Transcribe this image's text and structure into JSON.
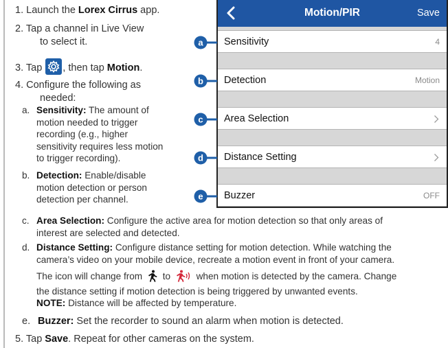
{
  "steps": {
    "s1": {
      "num": "1.",
      "pre": "Launch the ",
      "bold": "Lorex Cirrus",
      "post": " app."
    },
    "s2": {
      "num": "2.",
      "line1": "Tap a channel in Live View",
      "line2": "to select it."
    },
    "s3": {
      "num": "3.",
      "pre": "Tap ",
      "mid": ", then tap ",
      "bold": "Motion",
      "post": "."
    },
    "s4": {
      "num": "4.",
      "line1": "Configure the following as",
      "line2": "needed:"
    },
    "s5": {
      "num": "5.",
      "pre": "Tap ",
      "bold": "Save",
      "post": ". Repeat for other cameras on the system."
    }
  },
  "items": {
    "a": {
      "letter": "a.",
      "bold": "Sensitivity:",
      "l1": " The amount of",
      "l2": "motion needed to trigger",
      "l3": "recording (e.g., higher",
      "l4": "sensitivity requires less motion",
      "l5": "to trigger recording)."
    },
    "b": {
      "letter": "b.",
      "bold": "Detection:",
      "l1": " Enable/disable",
      "l2": "motion detection or person",
      "l3": "detection per channel."
    },
    "c": {
      "letter": "c.",
      "bold": "Area Selection:",
      "l1": " Configure the active area for motion detection so that only areas of",
      "l2": "interest are selected and detected."
    },
    "d": {
      "letter": "d.",
      "bold": "Distance Setting:",
      "l1": " Configure distance setting for motion detection. While watching the",
      "l2": "camera’s video on your mobile device, recreate a motion event in front of your camera.",
      "p2a": "The icon will change from ",
      "p2b": " to ",
      "p2c": " when motion is detected by the camera. Change",
      "p2l2": "the distance setting if motion detection is being triggered by unwanted events.",
      "note_label": "NOTE:",
      "note": " Distance will be affected by temperature."
    },
    "e": {
      "letter": "e.",
      "bold": "Buzzer:",
      "l1": " Set the recorder to sound an alarm when motion is detected."
    }
  },
  "phone": {
    "title": "Motion/PIR",
    "save": "Save",
    "rows": [
      {
        "label": "Sensitivity",
        "value": "4"
      },
      {
        "label": "Detection",
        "value": "Motion"
      },
      {
        "label": "Area Selection",
        "value": ""
      },
      {
        "label": "Distance Setting",
        "value": ""
      },
      {
        "label": "Buzzer",
        "value": "OFF"
      }
    ]
  },
  "callouts": [
    "a",
    "b",
    "c",
    "d",
    "e"
  ],
  "colors": {
    "accent": "#1f56a3",
    "callout": "#1f5fa8"
  },
  "icons": {
    "back": "chevron-left-icon",
    "settings": "gear-icon",
    "chevron": "chevron-right-icon",
    "person": "person-walking-icon",
    "person_motion": "person-motion-icon"
  }
}
